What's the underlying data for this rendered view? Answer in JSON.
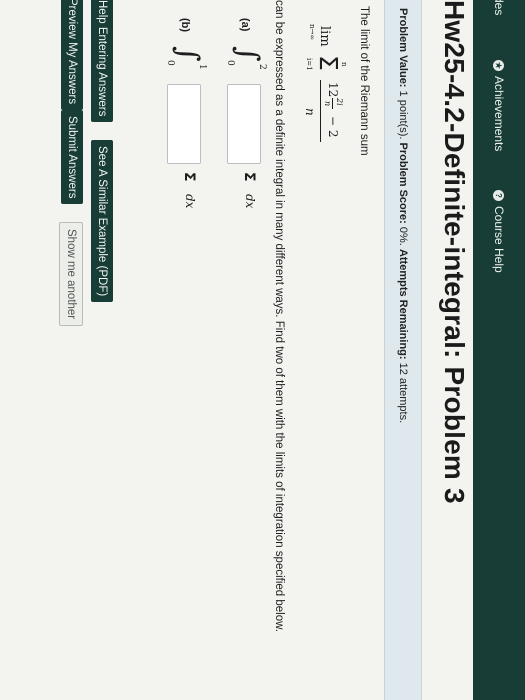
{
  "nav": {
    "items": [
      {
        "label": "des"
      },
      {
        "label": "Achievements",
        "icon": "star-icon"
      },
      {
        "label": "Course Help",
        "icon": "question-icon"
      }
    ]
  },
  "problem": {
    "title": "Hw25-4.2-Definite-integral: Problem 3",
    "info": {
      "value_label": "Problem Value:",
      "value": "1 point(s).",
      "score_label": "Problem Score:",
      "score": "0%.",
      "attempts_label": "Attempts Remaining:",
      "attempts": "12 attempts."
    },
    "prompt1": "The limit of the Riemann sum",
    "formula": {
      "lim": "lim",
      "lim_sub": "n→∞",
      "sum_top": "n",
      "sum_bottom": "i=1",
      "sigma": "Σ",
      "numerator": "12",
      "frac_num": "2i",
      "frac_den": "n",
      "minus": "− 2",
      "denominator": "n"
    },
    "prompt2": "can be expressed as a definite integral in many different ways. Find two of them with the limits of integration specified below.",
    "parts": [
      {
        "label": "(a)",
        "lower": "0",
        "upper": "2",
        "value": "",
        "sigma": "Σ",
        "dx": "dx"
      },
      {
        "label": "(b)",
        "lower": "0",
        "upper": "1",
        "value": "",
        "sigma": "Σ",
        "dx": "dx"
      }
    ]
  },
  "buttons": {
    "help_entering": "Help Entering Answers",
    "similar_example": "See A Similar Example (PDF)",
    "preview": "Preview My Answers",
    "submit": "Submit Answers",
    "show_another": "Show me another"
  },
  "colors": {
    "nav_background": "#173d36",
    "info_background": "#dfe8ec",
    "page_background": "#f3f4f0"
  }
}
